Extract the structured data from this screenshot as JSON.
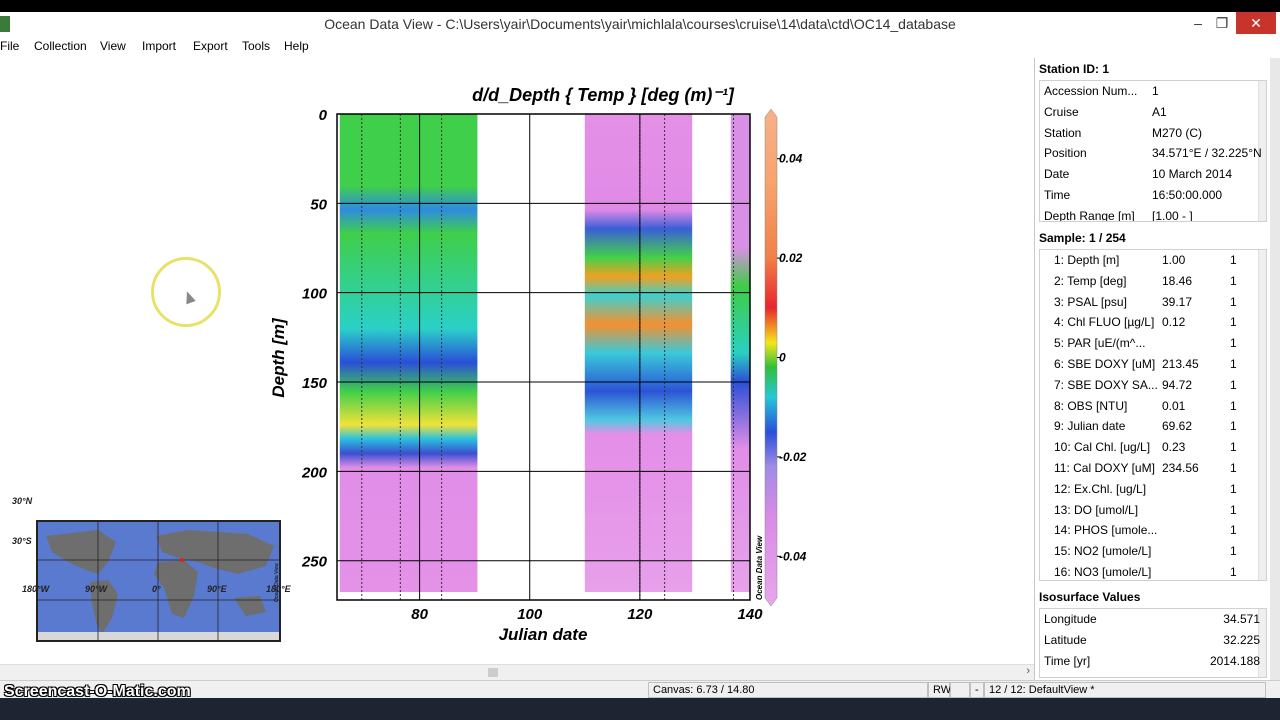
{
  "window": {
    "title": "Ocean Data View - C:\\Users\\yair\\Documents\\yair\\michlala\\courses\\cruise\\14\\data\\ctd\\OC14_database",
    "min": "–",
    "max": "❐",
    "close": "✕"
  },
  "menu": [
    "File",
    "Collection",
    "View",
    "Import",
    "Export",
    "Tools",
    "Help"
  ],
  "plot": {
    "title": "d/d_Depth { Temp } [deg (m)⁻¹]",
    "ylabel": "Depth [m]",
    "xlabel": "Julian date",
    "watermark": "Ocean Data View"
  },
  "colorbar": {
    "ticks": [
      "0.04",
      "0.02",
      "0",
      "-0.02",
      "-0.04"
    ]
  },
  "map": {
    "lat_labels": [
      "30°N",
      "30°S"
    ],
    "lon_labels": [
      "180°W",
      "90°W",
      "0°",
      "90°E",
      "180°E"
    ],
    "watermark": "Ocean Data View"
  },
  "station": {
    "header": "Station ID: 1",
    "rows": [
      {
        "k": "Accession Num...",
        "v": "1"
      },
      {
        "k": "Cruise",
        "v": "A1"
      },
      {
        "k": "Station",
        "v": "M270 (C)"
      },
      {
        "k": "Position",
        "v": "34.571°E / 32.225°N"
      },
      {
        "k": "Date",
        "v": "10 March 2014"
      },
      {
        "k": "Time",
        "v": "16:50:00.000"
      },
      {
        "k": "Depth Range [m]",
        "v": "[1.00 - ]"
      }
    ]
  },
  "sample": {
    "header": "Sample: 1 / 254",
    "rows": [
      {
        "k": "1: Depth [m]",
        "v": "1.00",
        "f": "1"
      },
      {
        "k": "2: Temp [deg]",
        "v": "18.46",
        "f": "1"
      },
      {
        "k": "3: PSAL [psu]",
        "v": "39.17",
        "f": "1"
      },
      {
        "k": "4: Chl FLUO [µg/L]",
        "v": "0.12",
        "f": "1"
      },
      {
        "k": "5: PAR [uE/(m^...",
        "v": "",
        "f": "1"
      },
      {
        "k": "6: SBE DOXY [uM]",
        "v": "213.45",
        "f": "1"
      },
      {
        "k": "7: SBE DOXY SA...",
        "v": "94.72",
        "f": "1"
      },
      {
        "k": "8: OBS [NTU]",
        "v": "0.01",
        "f": "1"
      },
      {
        "k": "9: Julian date",
        "v": "69.62",
        "f": "1"
      },
      {
        "k": "10: Cal Chl. [ug/L]",
        "v": "0.23",
        "f": "1"
      },
      {
        "k": "11: Cal DOXY [uM]",
        "v": "234.56",
        "f": "1"
      },
      {
        "k": "12: Ex.Chl. [ug/L]",
        "v": "",
        "f": "1"
      },
      {
        "k": "13: DO [umol/L]",
        "v": "",
        "f": "1"
      },
      {
        "k": "14: PHOS [umole...",
        "v": "",
        "f": "1"
      },
      {
        "k": "15: NO2 [umole/L]",
        "v": "",
        "f": "1"
      },
      {
        "k": "16: NO3 [umole/L]",
        "v": "",
        "f": "1"
      }
    ]
  },
  "isosurface": {
    "header": "Isosurface Values",
    "rows": [
      {
        "k": "Longitude",
        "v": "34.571"
      },
      {
        "k": "Latitude",
        "v": "32.225"
      },
      {
        "k": "Time [yr]",
        "v": "2014.188"
      }
    ]
  },
  "status": {
    "canvas": "Canvas:  6.73 / 14.80",
    "rw": "RW",
    "dash": "-",
    "view": "12 / 12: DefaultView *"
  },
  "watermark": "Screencast-O-Matic.com",
  "chart_data": {
    "type": "heatmap",
    "title": "d/d_Depth { Temp } [deg (m)⁻¹]",
    "xlabel": "Julian date",
    "ylabel": "Depth [m]",
    "xlim": [
      65,
      140
    ],
    "ylim": [
      272,
      0
    ],
    "x_ticks": [
      80,
      100,
      120,
      140
    ],
    "y_ticks": [
      0,
      50,
      100,
      150,
      200,
      250
    ],
    "grid": true,
    "colorbar_range": [
      -0.05,
      0.05
    ],
    "colorbar_ticks": [
      0.04,
      0.02,
      0,
      -0.02,
      -0.04
    ],
    "data_segments": [
      {
        "x_start": 65.5,
        "x_end": 90.5
      },
      {
        "x_start": 110,
        "x_end": 129.5
      },
      {
        "x_start": 136.5,
        "x_end": 140
      }
    ],
    "station_lines_x": [
      69.5,
      76.5,
      84,
      120,
      124.5,
      137
    ]
  }
}
